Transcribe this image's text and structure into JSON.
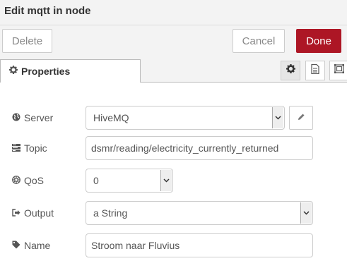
{
  "header": {
    "title": "Edit mqtt in node"
  },
  "toolbar": {
    "delete_label": "Delete",
    "cancel_label": "Cancel",
    "done_label": "Done"
  },
  "tabs": {
    "properties_label": "Properties"
  },
  "form": {
    "server": {
      "label": "Server",
      "value": "HiveMQ"
    },
    "topic": {
      "label": "Topic",
      "value": "dsmr/reading/electricity_currently_returned"
    },
    "qos": {
      "label": "QoS",
      "value": "0"
    },
    "output": {
      "label": "Output",
      "value": "a String"
    },
    "name": {
      "label": "Name",
      "value": "Stroom naar Fluvius"
    }
  },
  "icons": {
    "tab": "cog-icon",
    "server": "globe-icon",
    "topic": "tasks-icon",
    "qos": "empire-icon",
    "output": "sign-out-icon",
    "name": "tag-icon",
    "edit": "pencil-icon",
    "settings": "cog-icon",
    "description": "file-text-icon",
    "appearance": "object-group-icon"
  },
  "colors": {
    "done_button": "#ad1625",
    "header_bg": "#f3f3f3"
  }
}
